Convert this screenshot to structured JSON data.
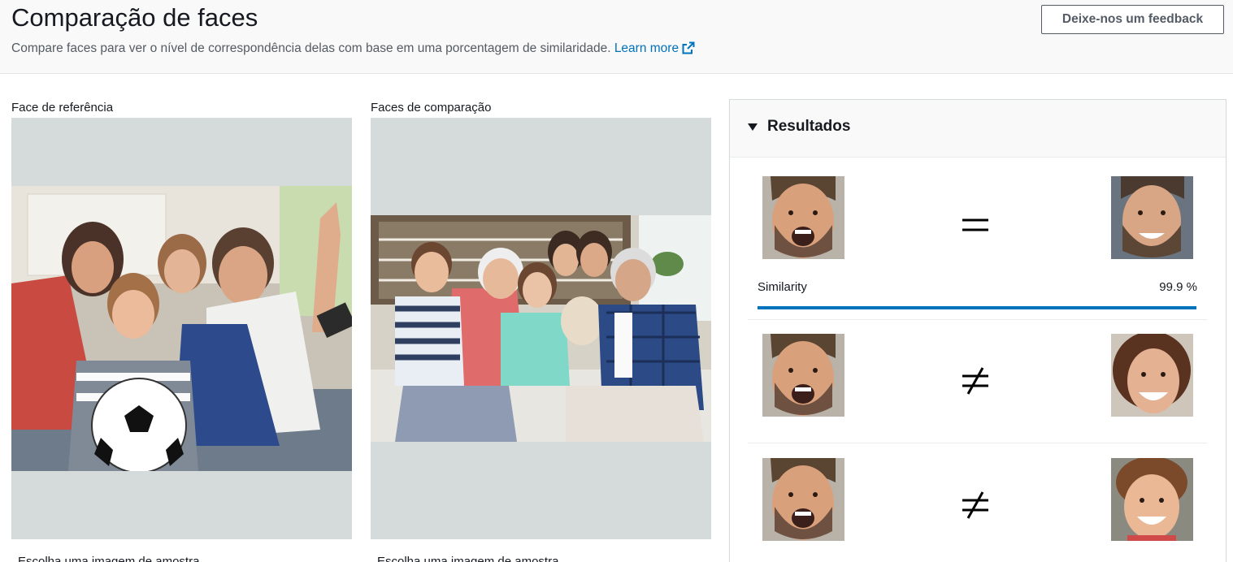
{
  "header": {
    "title": "Comparação de faces",
    "description": "Compare faces para ver o nível de correspondência delas com base em uma porcentagem de similaridade.",
    "learn_more": "Learn more",
    "learn_more_icon": "external-link-icon",
    "feedback_label": "Deixe-nos um feedback"
  },
  "reference_panel": {
    "label": "Face de referência",
    "image_icon": "family-watching-football-photo",
    "below_text": "Escolha uma imagem de amostra"
  },
  "comparison_panel": {
    "label": "Faces de comparação",
    "image_icon": "family-on-sofa-photo",
    "below_text": "Escolha uma imagem de amostra"
  },
  "results": {
    "title": "Resultados",
    "caret_icon": "caret-down-icon",
    "items": [
      {
        "reference_face": "bearded-man-face",
        "relation": "equals-icon",
        "comparison_face": "bearded-man-smiling-face",
        "similarity_label": "Similarity",
        "similarity_value": "99.9 %",
        "similarity_fraction": 0.999
      },
      {
        "reference_face": "bearded-man-face",
        "relation": "not-equals-icon",
        "comparison_face": "woman-smiling-face"
      },
      {
        "reference_face": "bearded-man-face",
        "relation": "not-equals-icon",
        "comparison_face": "boy-smiling-face"
      }
    ]
  },
  "colors": {
    "accent": "#0073bb",
    "image_background": "#d5dbdb",
    "header_background": "#f9f9f9"
  }
}
